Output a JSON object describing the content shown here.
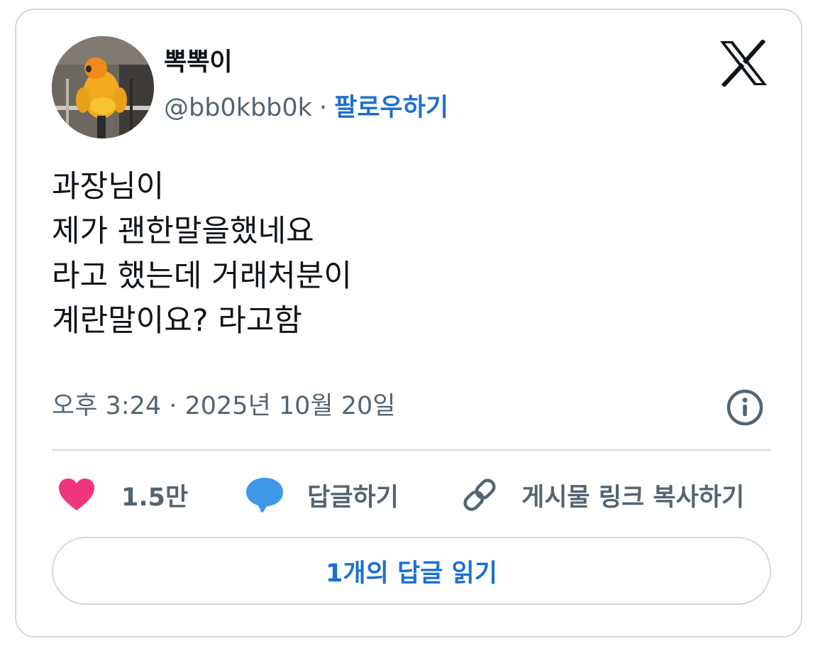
{
  "author": {
    "name": "뽁뽁이",
    "handle": "@bb0kbb0k",
    "separator": "·",
    "follow_label": "팔로우하기"
  },
  "icons": {
    "brand_logo": "x-logo-icon",
    "info": "info-icon",
    "like": "heart-icon",
    "reply": "speech-bubble-icon",
    "copy_link": "link-icon"
  },
  "tweet": {
    "lines": [
      "과장님이",
      "제가 괜한말을했네요",
      "라고 했는데 거래처분이",
      "계란말이요? 라고함"
    ]
  },
  "meta": {
    "timestamp": "오후 3:24 · 2025년 10월 20일"
  },
  "actions": {
    "like_count": "1.5만",
    "reply_label": "답글하기",
    "copy_link_label": "게시물 링크 복사하기"
  },
  "footer": {
    "read_replies_label": "1개의 답글 읽기"
  },
  "colors": {
    "accent": "#1d6fd0",
    "like": "#f0357d",
    "reply": "#3f97ea",
    "secondary_text": "#536471",
    "border": "#cfd9de"
  }
}
